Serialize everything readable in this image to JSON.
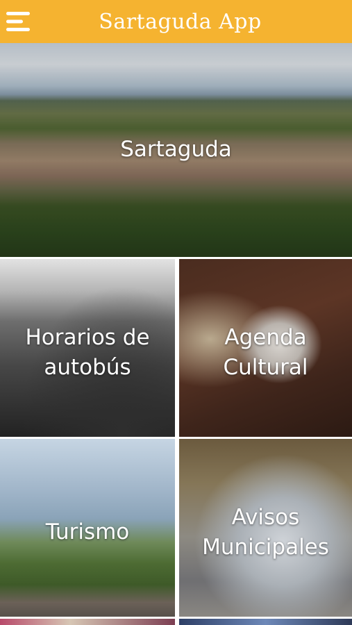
{
  "header": {
    "title": "Sartaguda App",
    "menu_icon": "hamburger-menu-icon",
    "background_color": "#f5b330"
  },
  "tiles": [
    {
      "label": "Sartaguda"
    },
    {
      "label_line1": "Horarios de",
      "label_line2": "autobús"
    },
    {
      "label_line1": "Agenda",
      "label_line2": "Cultural"
    },
    {
      "label": "Turismo"
    },
    {
      "label_line1": "Avisos",
      "label_line2": "Municipales"
    }
  ]
}
